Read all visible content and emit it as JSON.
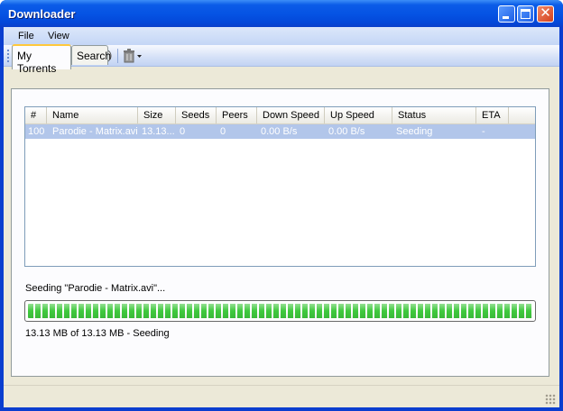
{
  "window": {
    "title": "Downloader"
  },
  "menu": {
    "items": [
      {
        "label": "File"
      },
      {
        "label": "View"
      }
    ]
  },
  "toolbar": {
    "buttons": [
      {
        "icon": "add-torrent-icon"
      },
      {
        "icon": "open-icon"
      },
      {
        "icon": "play-icon"
      },
      {
        "icon": "pause-icon"
      },
      {
        "icon": "stop-icon"
      },
      {
        "icon": "delete-icon"
      }
    ]
  },
  "tabs": [
    {
      "label": "My Torrents",
      "active": true
    },
    {
      "label": "Search",
      "active": false
    }
  ],
  "table": {
    "columns": [
      "#",
      "Name",
      "Size",
      "Seeds",
      "Peers",
      "Down Speed",
      "Up Speed",
      "Status",
      "ETA"
    ],
    "rows": [
      {
        "num": "100",
        "name": "Parodie - Matrix.avi",
        "size": "13.13...",
        "seeds": "0",
        "peers": "0",
        "down_speed": "0.00 B/s",
        "up_speed": "0.00 B/s",
        "status": "Seeding",
        "eta": "-"
      }
    ]
  },
  "progress": {
    "status_line": "Seeding \"Parodie - Matrix.avi\"...",
    "percent": 100,
    "size_line": "13.13 MB of 13.13 MB - Seeding",
    "bar_color": "#3fc83d"
  },
  "colors": {
    "titlebar": "#0552e3",
    "selection": "#b2c6ea",
    "tab_highlight": "#ffc83c"
  }
}
